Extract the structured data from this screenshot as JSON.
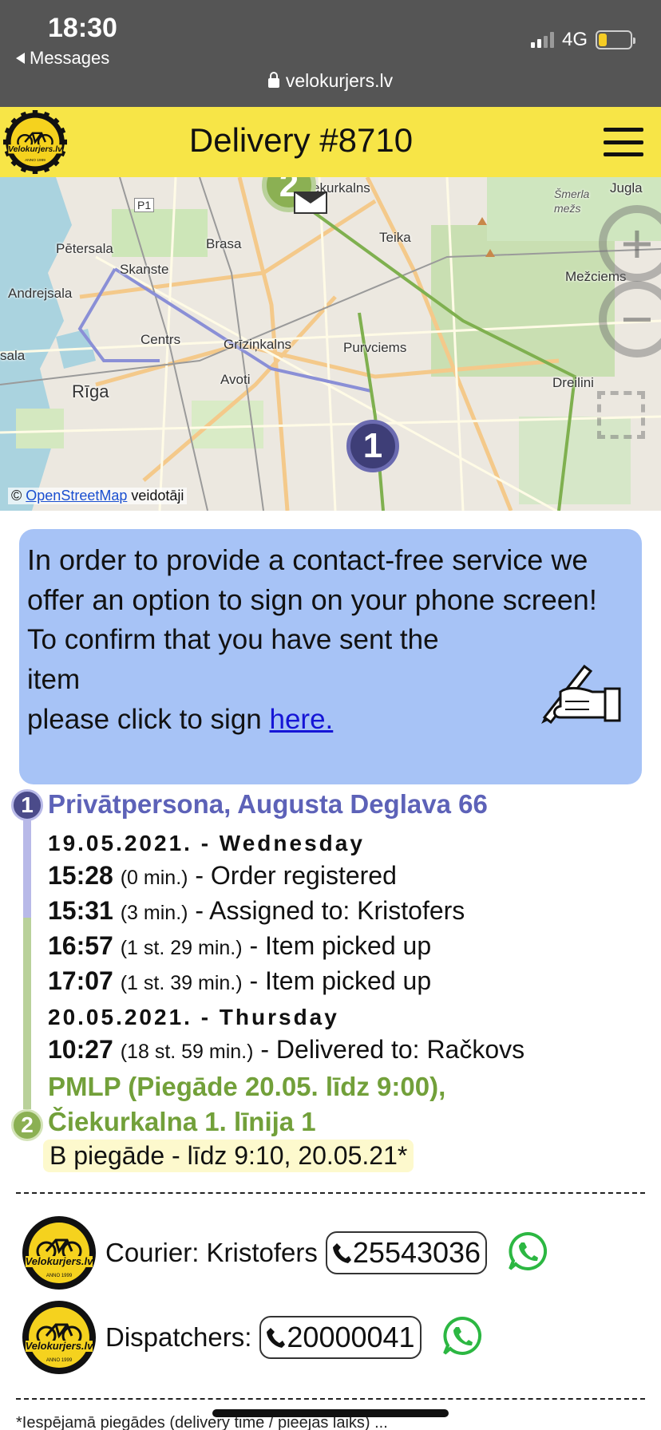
{
  "status_bar": {
    "time": "18:30",
    "back_app": "Messages",
    "network": "4G",
    "battery_level": 0.25,
    "battery_color": "#f5cc24"
  },
  "browser": {
    "url": "velokurjers.lv"
  },
  "header": {
    "title": "Delivery #8710",
    "logo_text": "Velokurjers.lv",
    "logo_subtext": "ANNO 1999",
    "brand_color": "#f7e547"
  },
  "map": {
    "places": [
      "Čiekurkalns",
      "Jugla",
      "Šmerla mežs",
      "Pētersala",
      "Brasa",
      "Teika",
      "Skanste",
      "Mežciems",
      "Andrejsala",
      "Centrs",
      "Grīziņkalns",
      "Purvciems",
      "Rīga",
      "Avoti",
      "Dreilini",
      "sala",
      "P1"
    ],
    "attribution_prefix": "©",
    "attribution_link": "OpenStreetMap",
    "attribution_suffix": "veidotāji",
    "zoom_in": "+",
    "zoom_out": "−",
    "marker_1": "1",
    "marker_2": "2"
  },
  "info": {
    "headline": "In order to provide a contact-free service we offer an option to sign on your phone screen!",
    "line1": "To confirm that you have sent the item",
    "line2_prefix": "please click to sign",
    "link": "here."
  },
  "timeline": {
    "pickup_pin": "1",
    "pickup_address": "Privātpersona, Augusta Deglava 66",
    "date1": "19.05.2021. - Wednesday",
    "events1": [
      {
        "time": "15:28",
        "duration": "(0 min.)",
        "text": "- Order registered"
      },
      {
        "time": "15:31",
        "duration": "(3 min.)",
        "text": "- Assigned to: Kristofers"
      },
      {
        "time": "16:57",
        "duration": "(1 st. 29 min.)",
        "text": "- Item picked up"
      },
      {
        "time": "17:07",
        "duration": "(1 st. 39 min.)",
        "text": "- Item picked up"
      }
    ],
    "date2": "20.05.2021. - Thursday",
    "events2": [
      {
        "time": "10:27",
        "duration": "(18 st. 59 min.)",
        "text": "- Delivered to: Račkovs"
      }
    ],
    "dropoff_pin": "2",
    "dropoff_line1": "PMLP (Piegāde 20.05. līdz 9:00),",
    "dropoff_line2": "Čiekurkalna 1. līnija 1",
    "note": "B piegāde - līdz 9:10, 20.05.21*"
  },
  "contacts": {
    "courier_label": "Courier: Kristofers",
    "courier_phone": "25543036",
    "dispatcher_label": "Dispatchers:",
    "dispatcher_phone": "20000041"
  },
  "footer": {
    "text": "*Iespējamā piegādes (delivery time / pieejas laiks) ..."
  }
}
